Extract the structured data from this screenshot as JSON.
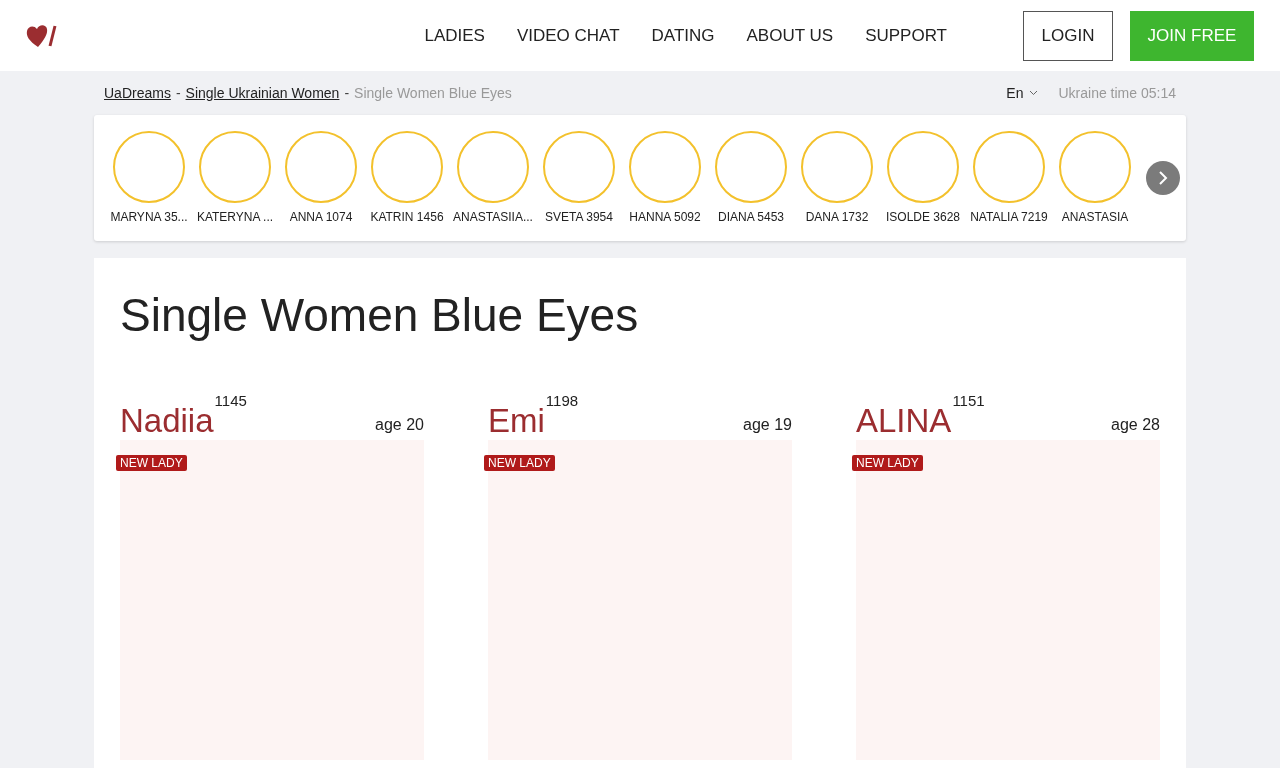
{
  "nav": {
    "items": [
      "LADIES",
      "VIDEO CHAT",
      "DATING",
      "ABOUT US",
      "SUPPORT"
    ],
    "login": "LOGIN",
    "join": "JOIN FREE"
  },
  "breadcrumbs": {
    "links": [
      "UaDreams",
      "Single Ukrainian Women"
    ],
    "separators": [
      "-",
      "-"
    ],
    "current": "Single Women Blue Eyes",
    "language": "En",
    "time": "Ukraine time 05:14"
  },
  "stories": [
    {
      "name": "MARYNA 35..."
    },
    {
      "name": "KATERYNA ..."
    },
    {
      "name": "ANNA 1074"
    },
    {
      "name": "KATRIN 1456"
    },
    {
      "name": "ANASTASIIA..."
    },
    {
      "name": "SVETA 3954"
    },
    {
      "name": "HANNA 5092"
    },
    {
      "name": "DIANA 5453"
    },
    {
      "name": "DANA 1732"
    },
    {
      "name": "ISOLDE 3628"
    },
    {
      "name": "NATALIA 7219"
    },
    {
      "name": "ANASTASIA"
    }
  ],
  "title": "Single Women Blue Eyes",
  "profiles": [
    {
      "name": "Nadiia",
      "id": "1145",
      "age": "age 20",
      "badge": "NEW LADY"
    },
    {
      "name": "Emi",
      "id": "1198",
      "age": "age 19",
      "badge": "NEW LADY"
    },
    {
      "name": "ALINA",
      "id": "1151",
      "age": "age 28",
      "badge": "NEW LADY"
    }
  ]
}
